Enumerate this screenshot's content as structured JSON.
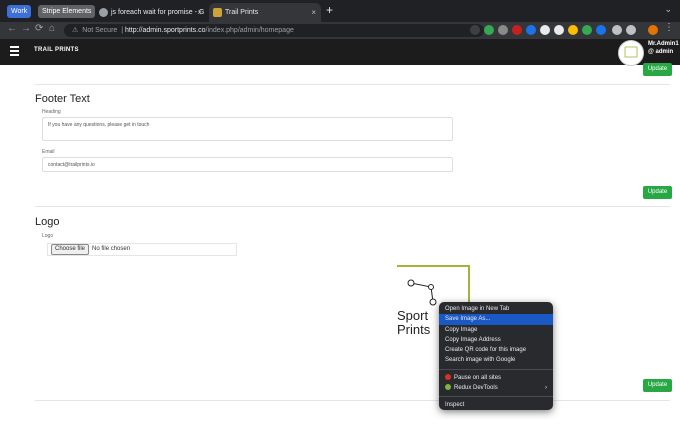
{
  "browser": {
    "tab_groups": [
      {
        "label": "Work"
      },
      {
        "label": "Stripe Elements"
      }
    ],
    "tabs": [
      {
        "title": "js foreach wait for promise - G"
      },
      {
        "title": "Trail Prints"
      }
    ],
    "new_tab_label": "+",
    "close_glyph": "×",
    "url_security": "Not Secure",
    "url_host": "http://admin.sportprints.co",
    "url_path": "/index.php/admin/homepage"
  },
  "app": {
    "brand": "TRAIL PRINTS",
    "user_name": "Mr.Admin1",
    "user_handle": "@ admin"
  },
  "page": {
    "update_label": "Update",
    "footer": {
      "title": "Footer Text",
      "heading_label": "Heading",
      "heading_value": "If you have any questions, please get in touch",
      "email_label": "Email",
      "email_value": "contact@trailprints.io"
    },
    "logo": {
      "title": "Logo",
      "label": "Logo",
      "file_button": "Choose file",
      "file_status": "No file chosen",
      "preview_line1": "Sport",
      "preview_line2": "Prints"
    }
  },
  "context_menu": {
    "items": [
      {
        "label": "Open Image in New Tab"
      },
      {
        "label": "Save Image As..."
      },
      {
        "label": "Copy Image"
      },
      {
        "label": "Copy Image Address"
      },
      {
        "label": "Create QR code for this image"
      },
      {
        "label": "Search image with Google"
      }
    ],
    "extension_items": [
      {
        "label": "Pause on all sites"
      },
      {
        "label": "Redux DevTools"
      }
    ],
    "inspect_label": "Inspect"
  },
  "colors": {
    "update_button": "#28a745",
    "menu_highlight": "#1a58c4",
    "logo_border": "#a5b33b"
  }
}
